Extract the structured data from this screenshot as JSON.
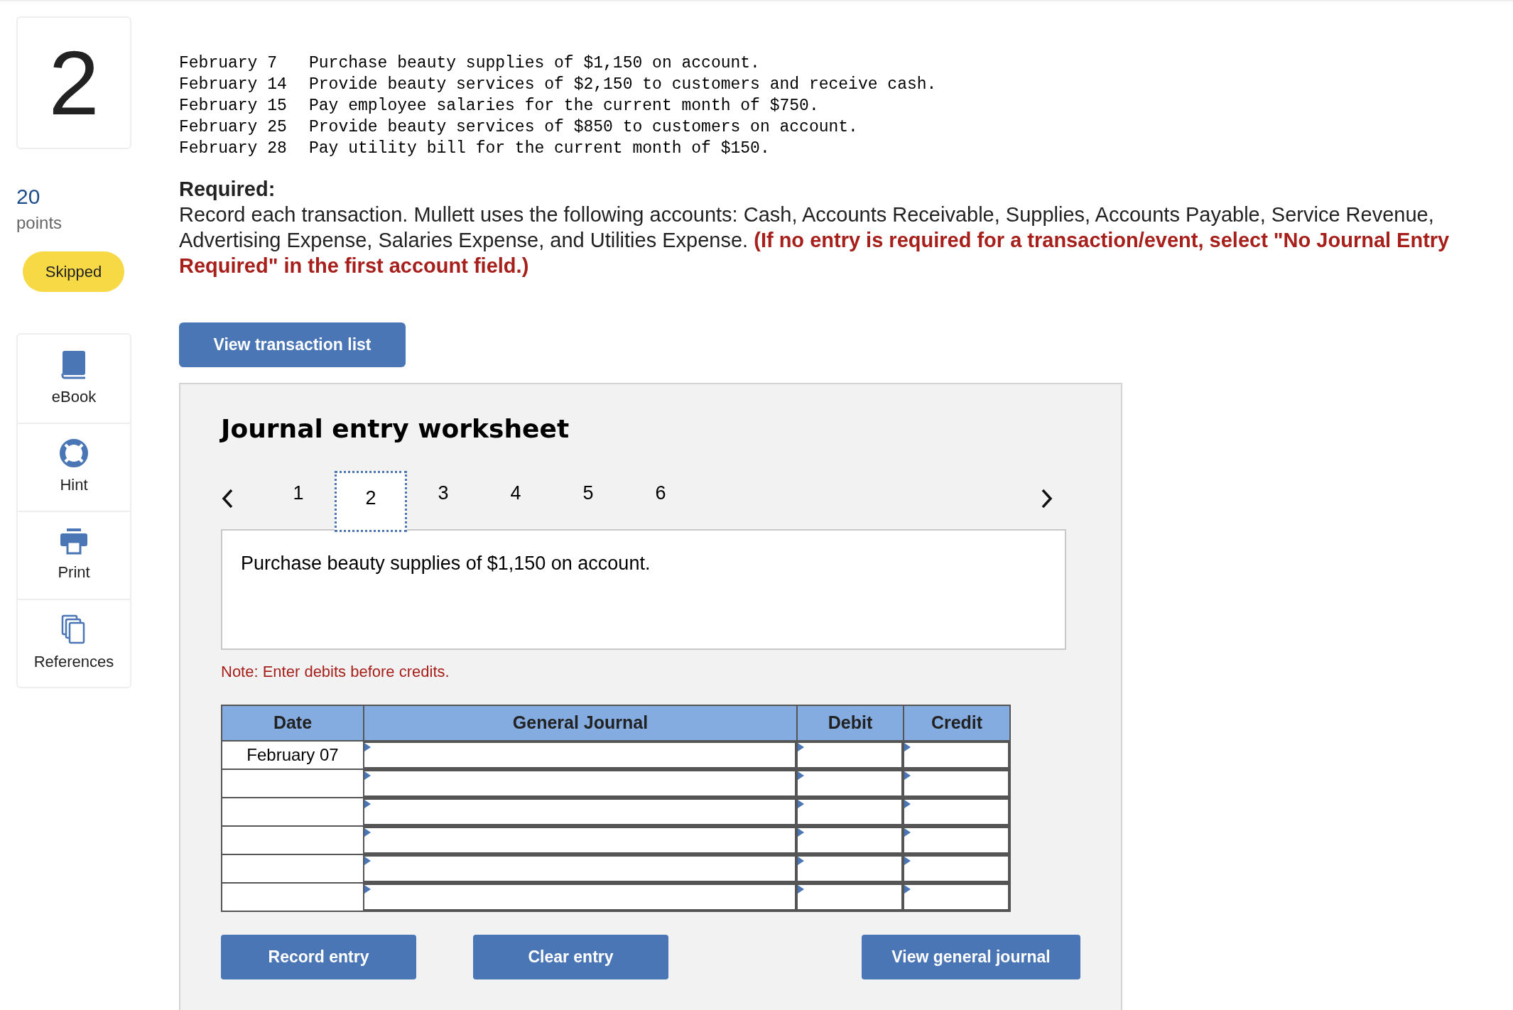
{
  "question": {
    "number": "2",
    "points": "20",
    "points_label": "points",
    "status": "Skipped"
  },
  "sidebar": {
    "items": [
      {
        "kind": "book",
        "label": "eBook"
      },
      {
        "kind": "lifebuoy",
        "label": "Hint"
      },
      {
        "kind": "printer",
        "label": "Print"
      },
      {
        "kind": "pages",
        "label": "References"
      }
    ]
  },
  "transactions": [
    {
      "date": "February 7",
      "text": "Purchase beauty supplies of $1,150 on account."
    },
    {
      "date": "February 14",
      "text": "Provide beauty services of $2,150 to customers and receive cash."
    },
    {
      "date": "February 15",
      "text": "Pay employee salaries for the current month of $750."
    },
    {
      "date": "February 25",
      "text": "Provide beauty services of $850 to customers on account."
    },
    {
      "date": "February 28",
      "text": "Pay utility bill for the current month of $150."
    }
  ],
  "required": {
    "heading": "Required:",
    "text": "Record each transaction. Mullett uses the following accounts: Cash, Accounts Receivable, Supplies, Accounts Payable, Service Revenue, Advertising Expense, Salaries Expense, and Utilities Expense.",
    "note": "(If no entry is required for a transaction/event, select \"No Journal Entry Required\" in the first account field.)"
  },
  "view_transactions_button": "View transaction list",
  "worksheet": {
    "title": "Journal entry worksheet",
    "tabs": [
      {
        "label": "1",
        "selected": false
      },
      {
        "label": "2",
        "selected": true
      },
      {
        "label": "3",
        "selected": false
      },
      {
        "label": "4",
        "selected": false
      },
      {
        "label": "5",
        "selected": false
      },
      {
        "label": "6",
        "selected": false
      }
    ],
    "description": "Purchase beauty supplies of $1,150 on account.",
    "note": "Note: Enter debits before credits.",
    "table": {
      "columns": [
        "Date",
        "General Journal",
        "Debit",
        "Credit"
      ],
      "rows": [
        {
          "date": "February 07"
        },
        {},
        {},
        {},
        {},
        {}
      ]
    },
    "buttons": [
      "Record entry",
      "Clear entry",
      "View general journal"
    ]
  }
}
